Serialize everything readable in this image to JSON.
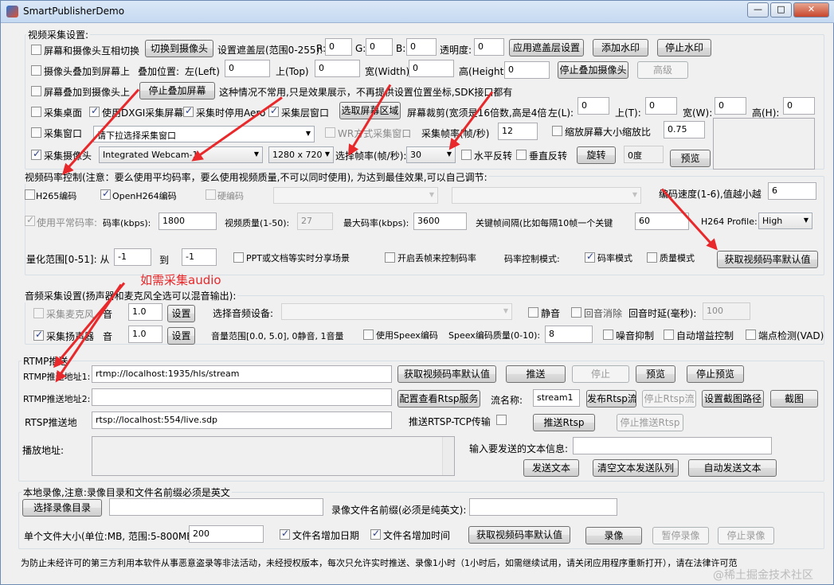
{
  "window": {
    "title": "SmartPublisherDemo",
    "min": "—",
    "max": "□",
    "close": "✕"
  },
  "video": {
    "group_title": "视频采集设置:",
    "screen_cam_switch": "屏幕和摄像头互相切换",
    "switch_to_camera": "切换到摄像头",
    "mask_label": "设置遮盖层(范围0-255):",
    "r": "R:",
    "g": "G:",
    "b": "B:",
    "r_val": "0",
    "g_val": "0",
    "b_val": "0",
    "transparency": "透明度:",
    "transparency_val": "0",
    "apply_mask": "应用遮盖层设置",
    "add_watermark": "添加水印",
    "stop_watermark": "停止水印",
    "cam_overlay_screen": "摄像头叠加到屏幕上",
    "overlay_pos": "叠加位置:",
    "left": "左(Left)",
    "left_val": "0",
    "top": "上(Top)",
    "top_val": "0",
    "width": "宽(Width)",
    "width_val": "0",
    "height": "高(Height)",
    "height_val": "0",
    "stop_overlay_cam": "停止叠加摄像头",
    "advanced": "高级",
    "screen_overlay_cam": "屏幕叠加到摄像头上",
    "stop_overlay_screen": "停止叠加屏幕",
    "overlay_note": "这种情况不常用,只是效果展示，不再提供设置位置坐标,SDK接口都有",
    "capture_desktop": "采集桌面",
    "use_dxgi": "使用DXGI采集屏幕",
    "disable_aero": "采集时停用Aero",
    "capture_layer": "采集层窗口",
    "select_region": "选取屏幕区域",
    "crop_label": "屏幕裁剪(宽须是16倍数,高是4倍",
    "crop_left": "左(L):",
    "crop_left_val": "0",
    "crop_top": "上(T):",
    "crop_top_val": "0",
    "crop_w": "宽(W):",
    "crop_w_val": "0",
    "crop_h": "高(H):",
    "crop_h_val": "0",
    "capture_window": "采集窗口",
    "window_select": "请下拉选择采集窗口",
    "wr_capture": "WR方式采集窗口",
    "fps_label": "采集帧率(帧/秒)",
    "fps_val": "12",
    "scale_label": "缩放屏幕大小缩放比",
    "scale_val": "0.75",
    "capture_camera": "采集摄像头",
    "camera_select": "Integrated Webcam-1",
    "resolution": "1280 x 720",
    "fps_select_label": "选择帧率(帧/秒):",
    "fps_select": "30",
    "hflip": "水平反转",
    "vflip": "垂直反转",
    "rotate": "旋转",
    "rotate_val": "0度",
    "preview": "预览"
  },
  "encode": {
    "group_title": "视频码率控制(注意：要么使用平均码率，要么使用视频质量,不可以同时使用), 为达到最佳效果,可以自己调节:",
    "h265": "H265编码",
    "openh264": "OpenH264编码",
    "hw": "硬编码",
    "speed_label": "编码速度(1-6),值越小越",
    "speed_val": "6",
    "avg_bitrate": "使用平常码率:",
    "bitrate_label": "码率(kbps):",
    "bitrate_val": "1800",
    "quality_label": "视频质量(1-50):",
    "quality_val": "27",
    "max_bitrate_label": "最大码率(kbps):",
    "max_bitrate_val": "3600",
    "gop_label": "关键帧间隔(比如每隔10帧一个关键",
    "gop_val": "60",
    "profile_label": "H264 Profile:",
    "profile_val": "High",
    "qp_label": "量化范围[0-51]: 从",
    "qp_from": "-1",
    "qp_to_label": "到",
    "qp_to": "-1",
    "ppt": "PPT或文档等实时分享场景",
    "drop_frame": "开启丢帧来控制码率",
    "rc_mode": "码率控制模式:",
    "bitrate_mode": "码率模式",
    "quality_mode": "质量模式",
    "get_default": "获取视频码率默认值"
  },
  "audio": {
    "annotation": "如需采集audio",
    "group_title": "音频采集设置(扬声器和麦克风全选可以混音输出):",
    "mic": "采集麦克风",
    "vol": "音",
    "mic_vol": "1.0",
    "set": "设置",
    "select_device": "选择音频设备:",
    "mute": "静音",
    "echo_cancel": "回音消除",
    "echo_delay": "回音时延(毫秒):",
    "echo_delay_val": "100",
    "speaker": "采集扬声器",
    "speaker_vol": "1.0",
    "vol_range": "音量范围[0.0, 5.0], 0静音, 1音量",
    "speex": "使用Speex编码",
    "speex_quality": "Speex编码质量(0-10):",
    "speex_quality_val": "8",
    "noise": "噪音抑制",
    "agc": "自动增益控制",
    "vad": "端点检测(VAD)"
  },
  "rtmp": {
    "group_title": "RTMP推送",
    "url1_label": "RTMP推送地址1:",
    "url1": "rtmp://localhost:1935/hls/stream",
    "get_default": "获取视频码率默认值",
    "push": "推送",
    "stop": "停止",
    "preview": "预览",
    "stop_preview": "停止预览",
    "url2_label": "RTMP推送地址2:",
    "url2": "",
    "rtsp_config": "配置查看Rtsp服务",
    "stream_name_label": "流名称:",
    "stream_name": "stream1",
    "publish_rtsp": "发布Rtsp流",
    "stop_rtsp": "停止Rtsp流",
    "set_snapshot_path": "设置截图路径",
    "snapshot": "截图",
    "rtsp_label": "RTSP推送地",
    "rtsp_url": "rtsp://localhost:554/live.sdp",
    "rtsp_tcp": "推送RTSP-TCP传输",
    "push_rtsp": "推送Rtsp",
    "stop_push_rtsp": "停止推送Rtsp",
    "play_label": "播放地址:",
    "text_label": "输入要发送的文本信息:",
    "send_text": "发送文本",
    "clear_queue": "清空文本发送队列",
    "auto_send": "自动发送文本"
  },
  "record": {
    "group_title": "本地录像,注意:录像目录和文件名前缀必须是英文",
    "select_dir": "选择录像目录",
    "prefix_label": "录像文件名前缀(必须是纯英文):",
    "size_label": "单个文件大小(单位:MB, 范围:5-800MB):",
    "size_val": "200",
    "add_date": "文件名增加日期",
    "add_time": "文件名增加时间",
    "get_default": "获取视频码率默认值",
    "record": "录像",
    "pause": "暂停录像",
    "stop": "停止录像"
  },
  "footer": {
    "notice": "为防止未经许可的第三方利用本软件从事恶意盗录等非法活动，未经授权版本，每次只允许实时推送、录像1小时（1小时后，如需继续试用，请关闭应用程序重新打开），请在法律许可范",
    "watermark": "@稀土掘金技术社区"
  }
}
